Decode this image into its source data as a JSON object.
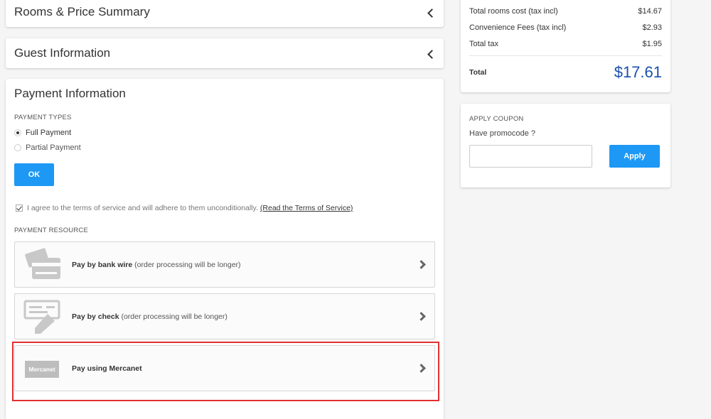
{
  "accordion": {
    "rooms_price": "Rooms & Price Summary",
    "guest_info": "Guest Information",
    "payment_info": "Payment Information"
  },
  "payment_types": {
    "heading": "PAYMENT TYPES",
    "full": "Full Payment",
    "partial": "Partial Payment",
    "ok_label": "OK",
    "selected": "Full Payment"
  },
  "terms": {
    "text": "I agree to the terms of service and will adhere to them unconditionally.",
    "link": "(Read the Terms of Service)",
    "checked": true
  },
  "payment_resource": {
    "heading": "PAYMENT RESOURCE",
    "options": [
      {
        "name": "Pay by bank wire",
        "note": "(order processing will be longer)",
        "icon": "bank-card-icon"
      },
      {
        "name": "Pay by check",
        "note": "(order processing will be longer)",
        "icon": "check-pen-icon"
      },
      {
        "name": "Pay using Mercanet",
        "note": "",
        "icon": "mercanet-logo",
        "badge": "Mercanet"
      }
    ]
  },
  "summary": {
    "rows": [
      {
        "label": "Total rooms cost (tax incl)",
        "value": "$14.67"
      },
      {
        "label": "Convenience Fees (tax incl)",
        "value": "$2.93"
      },
      {
        "label": "Total tax",
        "value": "$1.95"
      }
    ],
    "total_label": "Total",
    "total_value": "$17.61"
  },
  "coupon": {
    "heading": "APPLY COUPON",
    "prompt": "Have promocode ?",
    "input_value": "",
    "apply_label": "Apply"
  },
  "colors": {
    "accent": "#1d98f4",
    "total": "#1b4fae",
    "highlight": "#e42f2f"
  }
}
